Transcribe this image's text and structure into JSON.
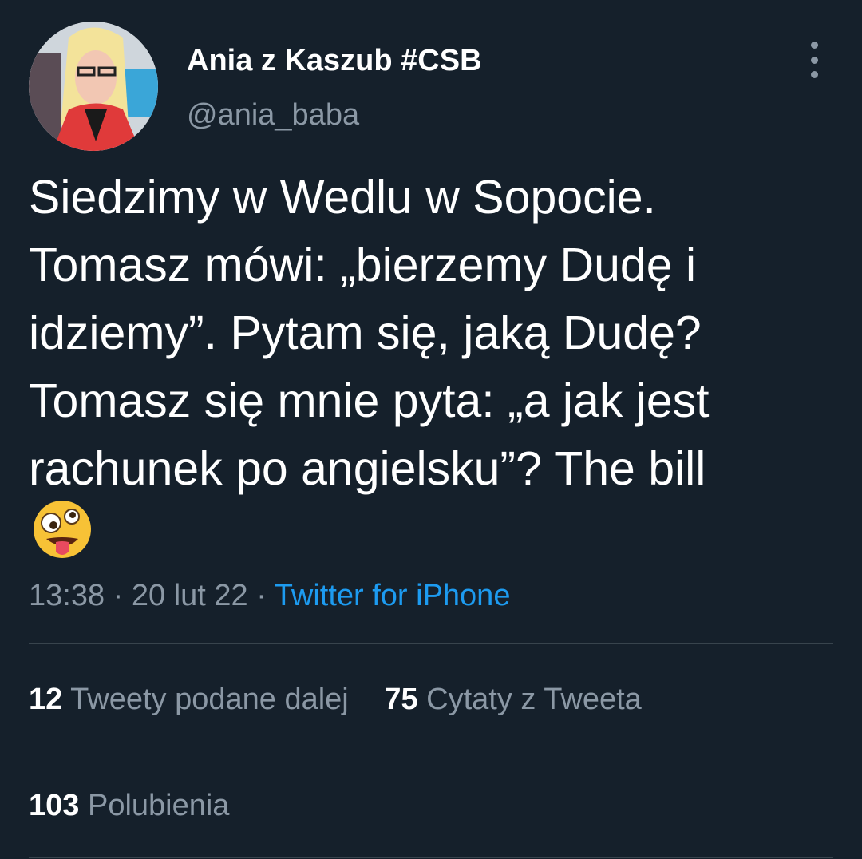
{
  "user": {
    "display_name": "Ania z Kaszub #CSB",
    "handle": "@ania_baba"
  },
  "tweet": {
    "lines": [
      "Siedzimy w Wedlu w Sopocie.",
      "Tomasz mówi: „bierzemy Dudę i",
      "idziemy”. Pytam się, jaką Dudę?",
      "Tomasz się mnie pyta: „a jak jest",
      "rachunek po angielsku”? The bill"
    ],
    "emoji": "zany-face-emoji"
  },
  "meta": {
    "time": "13:38",
    "date": "20 lut 22",
    "separator": "·",
    "source": "Twitter for iPhone"
  },
  "stats": {
    "retweets_count": "12",
    "retweets_label": "Tweety podane dalej",
    "quotes_count": "75",
    "quotes_label": "Cytaty z Tweeta",
    "likes_count": "103",
    "likes_label": "Polubienia"
  },
  "colors": {
    "background": "#15202b",
    "text": "#ffffff",
    "secondary": "#8b98a5",
    "accent": "#1d9bf0",
    "divider": "#38444d"
  },
  "icons": {
    "more": "more-vertical-icon"
  }
}
